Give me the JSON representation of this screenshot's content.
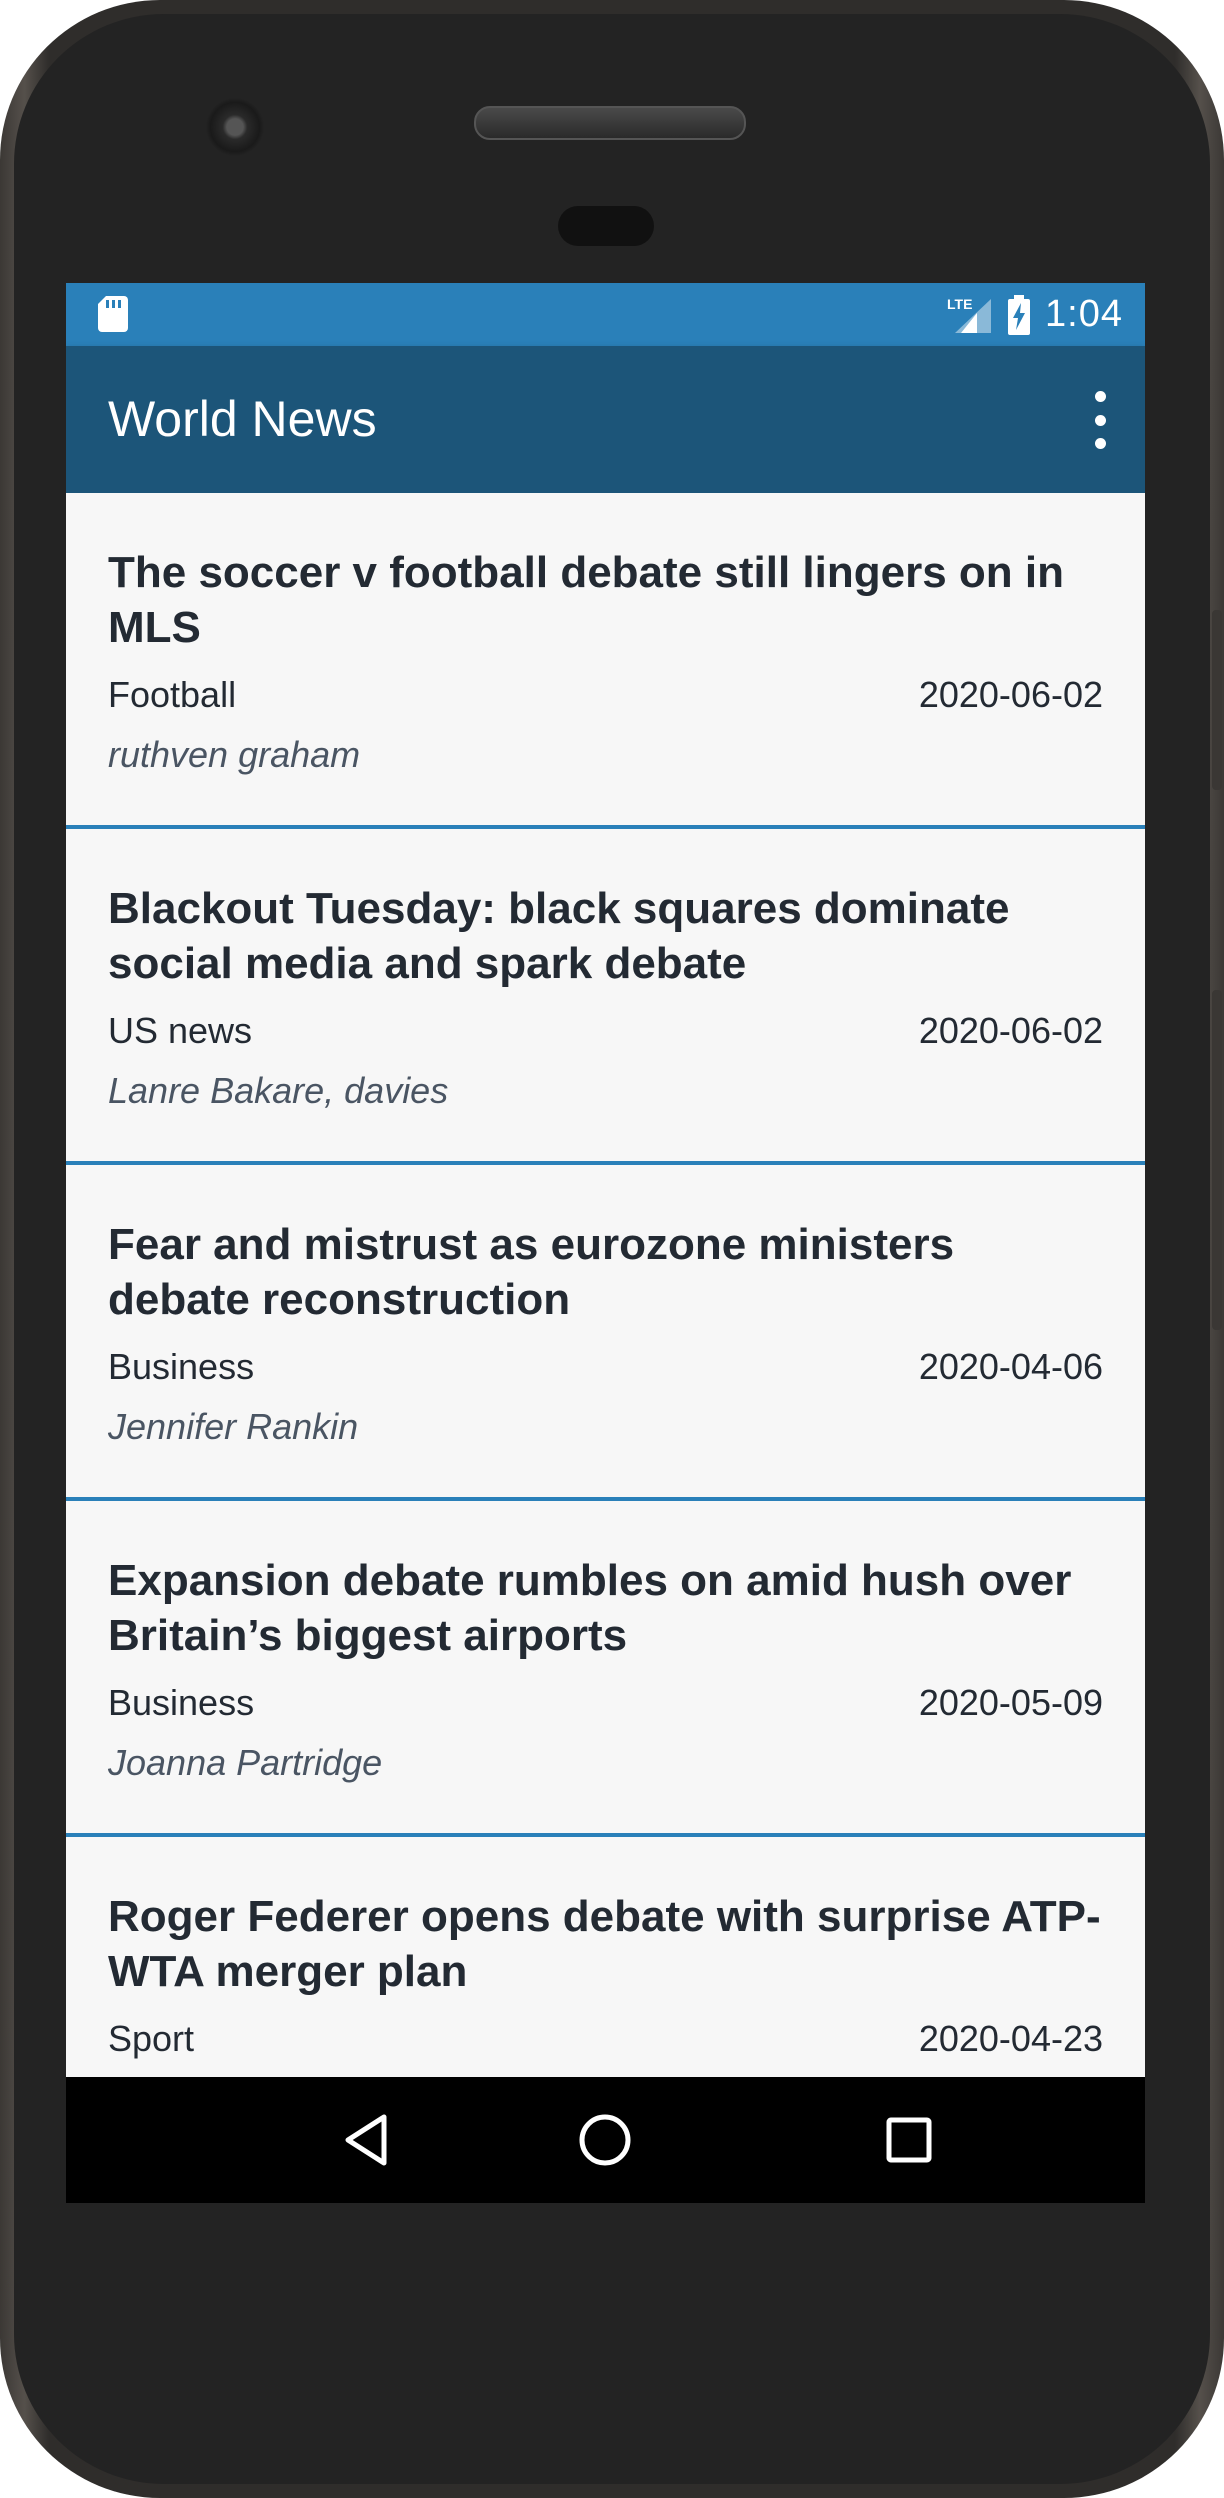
{
  "status_bar": {
    "time": "1:04",
    "network": "LTE",
    "icons": [
      "sd-card-icon",
      "signal-icon",
      "battery-charging-icon"
    ]
  },
  "app_bar": {
    "title": "World News",
    "menu_icon": "more-vert-icon"
  },
  "articles": [
    {
      "title": "The soccer v football debate still lingers on in MLS",
      "section": "Football",
      "date": "2020-06-02",
      "author": "ruthven graham"
    },
    {
      "title": "Blackout Tuesday: black squares dominate social media and spark debate",
      "section": "US news",
      "date": "2020-06-02",
      "author": "Lanre Bakare, davies"
    },
    {
      "title": "Fear and mistrust as eurozone ministers debate reconstruction",
      "section": "Business",
      "date": "2020-04-06",
      "author": "Jennifer Rankin"
    },
    {
      "title": "Expansion debate rumbles on amid hush over Britain’s biggest airports",
      "section": "Business",
      "date": "2020-05-09",
      "author": "Joanna Partridge"
    },
    {
      "title": "Roger Federer opens debate with surprise ATP-WTA merger plan",
      "section": "Sport",
      "date": "2020-04-23",
      "author": ""
    }
  ],
  "nav_bar": {
    "buttons": [
      "back-icon",
      "home-icon",
      "recents-icon"
    ]
  },
  "colors": {
    "status_bar": "#2a80b9",
    "app_bar": "#1c5579",
    "divider": "#2a80b9",
    "card_bg": "#f7f7f7",
    "text": "#232a33"
  }
}
